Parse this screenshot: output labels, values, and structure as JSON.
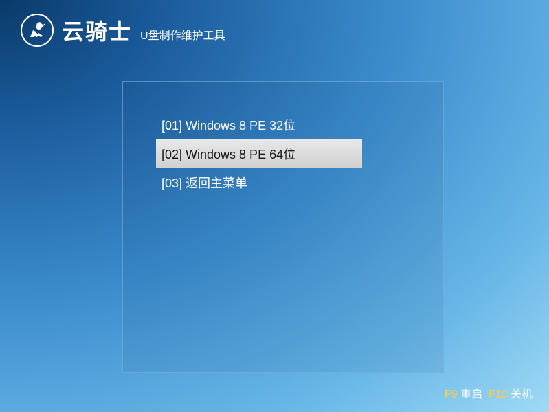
{
  "header": {
    "brand": "云骑士",
    "subtitle": "U盘制作维护工具"
  },
  "menu": {
    "items": [
      {
        "label": "[01] Windows 8 PE 32位",
        "selected": false
      },
      {
        "label": "[02] Windows 8 PE 64位",
        "selected": true
      },
      {
        "label": "[03] 返回主菜单",
        "selected": false
      }
    ]
  },
  "footer": {
    "key1": "F9",
    "label1": "重启",
    "key2": "F10",
    "label2": "关机"
  }
}
